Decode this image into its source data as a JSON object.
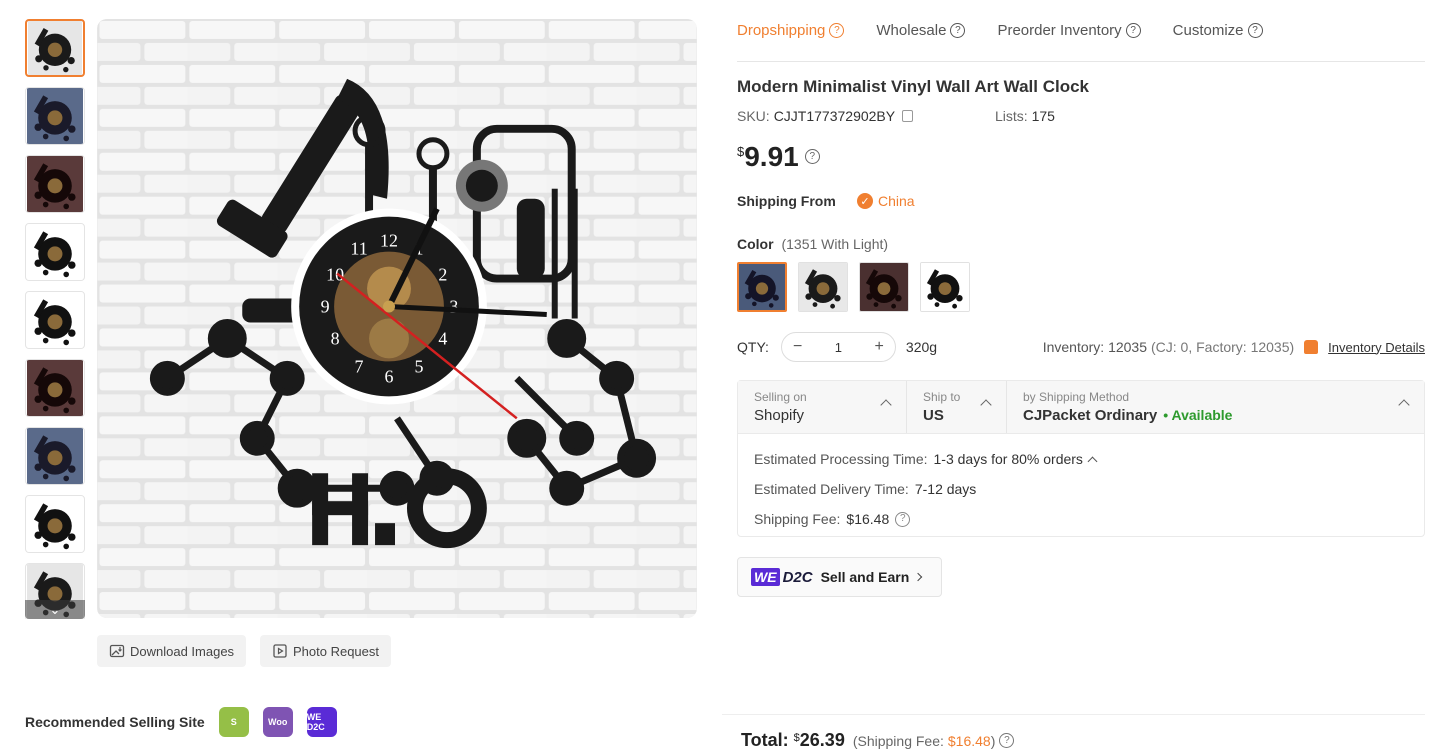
{
  "tabs": [
    {
      "label": "Dropshipping",
      "active": true
    },
    {
      "label": "Wholesale",
      "active": false
    },
    {
      "label": "Preorder Inventory",
      "active": false
    },
    {
      "label": "Customize",
      "active": false
    }
  ],
  "product": {
    "title": "Modern Minimalist Vinyl Wall Art Wall Clock",
    "sku_label": "SKU:",
    "sku": "CJJT177372902BY",
    "lists_label": "Lists:",
    "lists": "175",
    "price_currency": "$",
    "price": "9.91"
  },
  "shipping_from": {
    "label": "Shipping From",
    "country": "China"
  },
  "color": {
    "label": "Color",
    "selected": "(1351 With Light)",
    "swatch_count": 4
  },
  "qty": {
    "label": "QTY:",
    "value": "1",
    "weight": "320g",
    "inventory": "Inventory: 12035",
    "inventory_detail": "(CJ: 0, Factory: 12035)",
    "inventory_link": "Inventory Details"
  },
  "shipping": {
    "selling_on_label": "Selling on",
    "selling_on": "Shopify",
    "ship_to_label": "Ship to",
    "ship_to": "US",
    "method_label": "by Shipping Method",
    "method": "CJPacket Ordinary",
    "availability": "• Available",
    "processing_label": "Estimated Processing Time:",
    "processing": "1-3 days for 80% orders",
    "delivery_label": "Estimated Delivery Time:",
    "delivery": "7-12 days",
    "fee_label": "Shipping Fee:",
    "fee": "$16.48"
  },
  "d2c": {
    "we": "WE",
    "d2c": "D2C",
    "label": "Sell and Earn"
  },
  "gallery": {
    "download_label": "Download Images",
    "photo_request_label": "Photo Request",
    "thumbnail_count": 9,
    "scroll_glyph": "⌄"
  },
  "recommended": {
    "label": "Recommended Selling Site",
    "sites": [
      {
        "name": "shopify-icon",
        "text": "S",
        "color": "#95bf47"
      },
      {
        "name": "woocommerce-icon",
        "text": "Woo",
        "color": "#7f54b3"
      },
      {
        "name": "wed2c-icon",
        "text": "WE D2C",
        "color": "#5a2bd6"
      }
    ]
  },
  "total": {
    "label": "Total:",
    "currency": "$",
    "amount": "26.39",
    "fee_prefix": "(Shipping Fee:",
    "fee": "$16.48",
    "fee_suffix": ")"
  },
  "colors": {
    "accent": "#f07f30",
    "available": "#2d9a2d",
    "we_purple": "#5a2bd6"
  }
}
